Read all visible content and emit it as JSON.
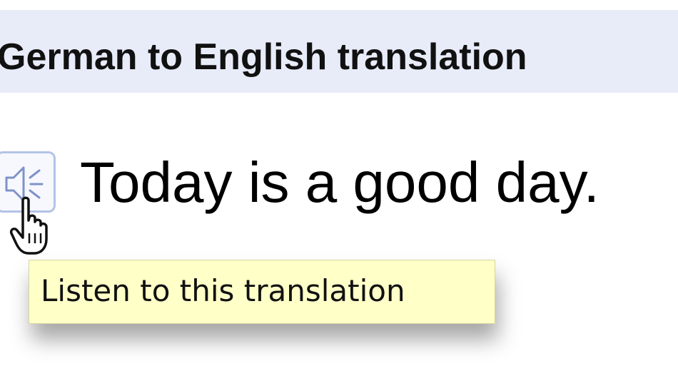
{
  "header": {
    "title": "German to English translation"
  },
  "result": {
    "translation_text": "Today is a good day."
  },
  "tooltip": {
    "text": "Listen to this translation"
  },
  "icons": {
    "listen": "speaker-icon",
    "cursor": "hand-pointer-icon"
  },
  "colors": {
    "header_background": "#e8ecf9",
    "tooltip_background": "#ffffc8",
    "button_border": "#b4c3e6"
  }
}
